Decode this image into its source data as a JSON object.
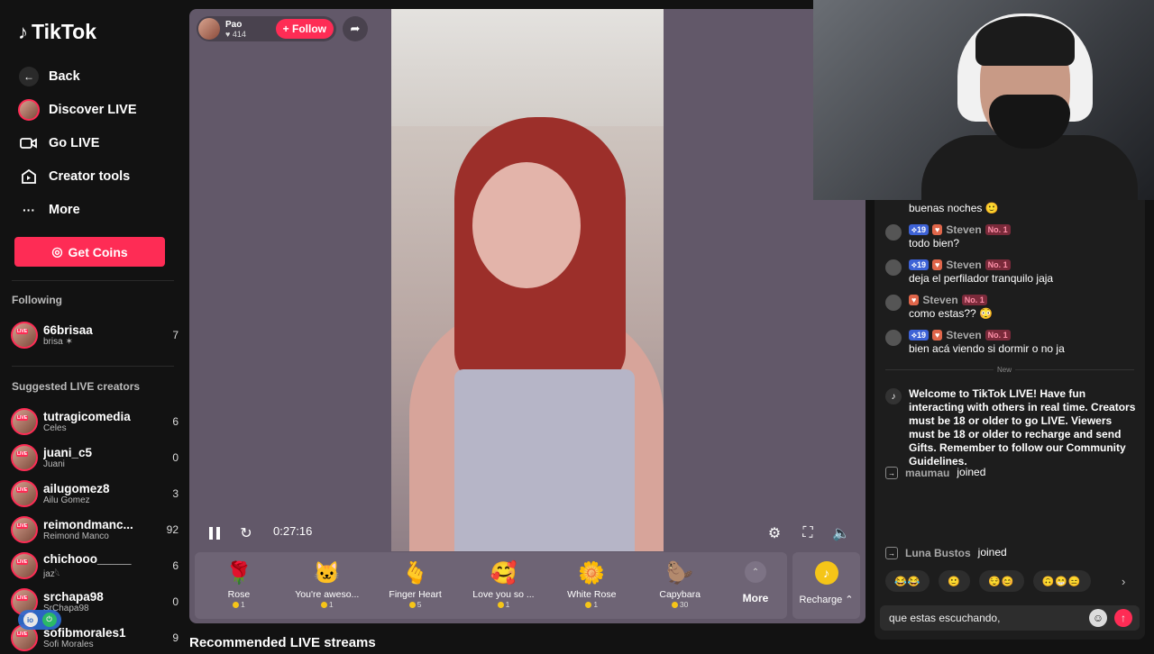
{
  "brand": {
    "logo": "TikTok"
  },
  "sidebar": {
    "nav": [
      {
        "label": "Back",
        "icon": "back-arrow-icon"
      },
      {
        "label": "Discover LIVE",
        "icon": "avatar-icon"
      },
      {
        "label": "Go LIVE",
        "icon": "camera-icon"
      },
      {
        "label": "Creator tools",
        "icon": "creator-tools-icon"
      },
      {
        "label": "More",
        "icon": "more-dots-icon"
      }
    ],
    "get_coins": "Get Coins",
    "following_title": "Following",
    "following": [
      {
        "name": "66brisaa",
        "sub": "brisa ✶",
        "count": "7"
      }
    ],
    "suggested_title": "Suggested LIVE creators",
    "suggested": [
      {
        "name": "tutragicomedia",
        "sub": "Celes",
        "count": "6"
      },
      {
        "name": "juani_c5",
        "sub": "Juani",
        "count": "0"
      },
      {
        "name": "ailugomez8",
        "sub": "Ailu Gomez",
        "count": "3"
      },
      {
        "name": "reimondmanc...",
        "sub": "Reimond Manco",
        "count": "92"
      },
      {
        "name": "chichooo_____",
        "sub": "jaz𓆩",
        "count": "6"
      },
      {
        "name": "srchapa98",
        "sub": "SrChapa98",
        "count": "0"
      },
      {
        "name": "sofibmorales1",
        "sub": "Sofi Morales",
        "count": "9"
      }
    ],
    "live_badge": "LIVE"
  },
  "player": {
    "streamer_name": "Pao",
    "likes": "♥ 414",
    "follow_label": "+ Follow",
    "time": "0:27:16",
    "gifts": [
      {
        "name": "Rose",
        "price": "1",
        "icon": "🌹"
      },
      {
        "name": "You're aweso...",
        "price": "1",
        "icon": "🐱"
      },
      {
        "name": "Finger Heart",
        "price": "5",
        "icon": "🫰"
      },
      {
        "name": "Love you so ...",
        "price": "1",
        "icon": "🥰"
      },
      {
        "name": "White Rose",
        "price": "1",
        "icon": "🌼"
      },
      {
        "name": "Capybara",
        "price": "30",
        "icon": "🦫"
      }
    ],
    "more_label": "More",
    "recharge_label": "Recharge ⌃"
  },
  "recommended_title": "Recommended LIVE streams",
  "chat": {
    "messages": [
      {
        "text": "buenas noches 🙂"
      },
      {
        "level": "19",
        "user": "Steven",
        "rank": "No. 1",
        "text": "todo bien?"
      },
      {
        "level": "19",
        "user": "Steven",
        "rank": "No. 1",
        "text": "deja el perfilador tranquilo jaja"
      },
      {
        "level": "",
        "user": "Steven",
        "rank": "No. 1",
        "text": "como estas?? 😳"
      },
      {
        "level": "19",
        "user": "Steven",
        "rank": "No. 1",
        "text": "bien acá viendo si dormir o no ja"
      }
    ],
    "new_label": "New",
    "welcome": "Welcome to TikTok LIVE! Have fun interacting with others in real time. Creators must be 18 or older to go LIVE. Viewers must be 18 or older to recharge and send Gifts. Remember to follow our Community Guidelines.",
    "joins": [
      {
        "user": "maumau",
        "action": "joined"
      },
      {
        "user": "Luna Bustos",
        "action": "joined"
      }
    ],
    "reactions": [
      "😂😂",
      "🙂",
      "😌😊",
      "🙃😁😑"
    ],
    "input_value": "que estas escuchando,"
  },
  "colors": {
    "accent": "#fe2c55",
    "coin": "#f5c518",
    "player_bg": "#625869"
  }
}
